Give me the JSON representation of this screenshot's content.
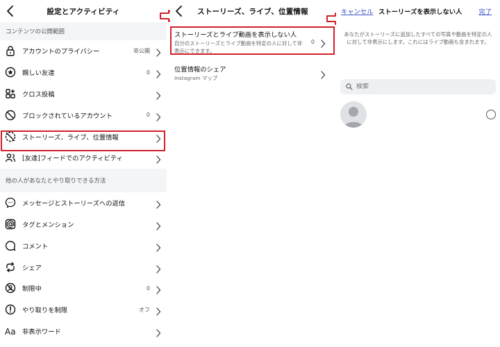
{
  "panel1": {
    "title": "設定とアクティビティ",
    "section1": "コンテンツの公開範囲",
    "items1": [
      {
        "label": "アカウントのプライバシー",
        "value": "非公開",
        "icon": "lock-icon"
      },
      {
        "label": "親しい友達",
        "value": "0",
        "icon": "star-circle-icon"
      },
      {
        "label": "クロス投稿",
        "value": "",
        "icon": "grid-plus-icon"
      },
      {
        "label": "ブロックされているアカウント",
        "value": "0",
        "icon": "block-icon"
      },
      {
        "label": "ストーリーズ、ライブ、位置情報",
        "value": "",
        "icon": "stories-off-icon"
      },
      {
        "label": "[友達]フィードでのアクティビティ",
        "value": "",
        "icon": "friends-icon"
      }
    ],
    "section2": "他の人があなたとやり取りできる方法",
    "items2": [
      {
        "label": "メッセージとストーリーズへの返信",
        "value": "",
        "icon": "messenger-icon"
      },
      {
        "label": "タグとメンション",
        "value": "",
        "icon": "at-icon"
      },
      {
        "label": "コメント",
        "value": "",
        "icon": "comment-icon"
      },
      {
        "label": "シェア",
        "value": "",
        "icon": "share-icon"
      },
      {
        "label": "制限中",
        "value": "0",
        "icon": "restrict-icon"
      },
      {
        "label": "やり取りを制限",
        "value": "オフ",
        "icon": "limit-icon"
      },
      {
        "label": "非表示ワード",
        "value": "",
        "icon": "text-aa-icon"
      }
    ]
  },
  "panel2": {
    "title": "ストーリーズ、ライブ、位置情報",
    "hide_title": "ストーリーズとライブ動画を表示しない人",
    "hide_desc": "自分のストーリーズとライブ動画を特定の人に対して非表示にできます。",
    "hide_count": "0",
    "loc_title": "位置情報のシェア",
    "loc_sub": "Instagram マップ"
  },
  "panel3": {
    "cancel": "キャンセル",
    "title": "ストーリーズを表示しない人",
    "done": "完了",
    "desc": "あなたがストーリーズに追加したすべての写真や動画を特定の人に対して非表示にします。これにはライブ動画も含まれます。",
    "search_placeholder": "検索"
  },
  "colors": {
    "highlight": "#d21f2b",
    "link": "#3854c8"
  }
}
